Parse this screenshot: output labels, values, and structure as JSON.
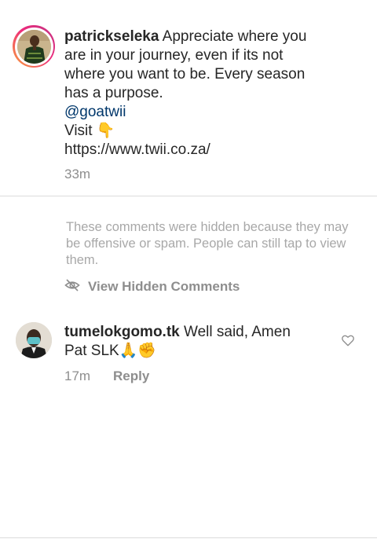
{
  "caption": {
    "username": "patrickseleka",
    "text_lines": [
      "Appreciate where you",
      "are in your journey, even if its not",
      "where you want to be. Every season",
      "has a purpose."
    ],
    "mention": "@goatwii",
    "visit_label": "Visit 👇",
    "link": "https://www.twii.co.za/",
    "timestamp": "33m"
  },
  "hidden_comments": {
    "notice": "These comments were hidden because they may be offensive or spam. People can still tap to view them.",
    "button_label": "View Hidden Comments",
    "icon": "eye-slash-icon"
  },
  "comment": {
    "username": "tumelokgomo.tk",
    "text_line1": "Well said, Amen",
    "text_line2": "Pat SLK🙏✊",
    "timestamp": "17m",
    "reply_label": "Reply",
    "like_icon": "heart-outline-icon"
  },
  "colors": {
    "text": "#262626",
    "muted": "#8e8e8e",
    "mention": "#00376b",
    "divider": "#dbdbdb"
  }
}
